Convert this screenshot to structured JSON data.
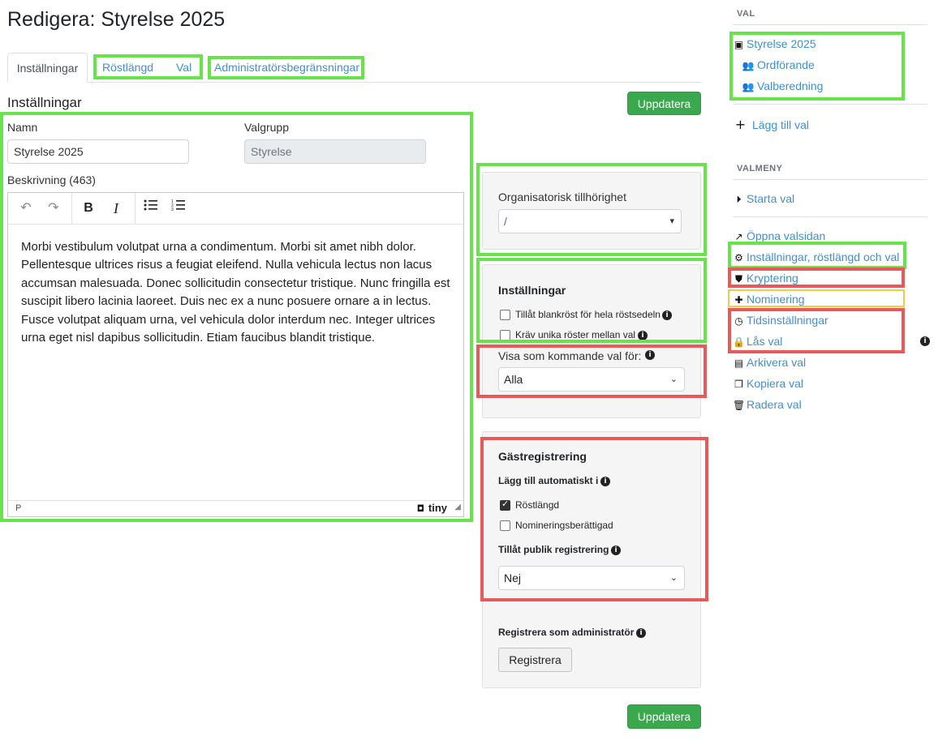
{
  "page": {
    "title": "Redigera: Styrelse 2025"
  },
  "tabs": [
    {
      "label": "Inställningar"
    },
    {
      "label": "Röstlängd"
    },
    {
      "label": "Val"
    },
    {
      "label": "Administratörsbegränsningar"
    }
  ],
  "settings": {
    "heading": "Inställningar",
    "update_label": "Uppdatera",
    "name_label": "Namn",
    "name_value": "Styrelse 2025",
    "group_label": "Valgrupp",
    "group_value": "Styrelse",
    "description_label": "Beskrivning (463)",
    "description_text": "Morbi vestibulum volutpat urna a condimentum. Morbi sit amet nibh dolor. Pellentesque ultrices risus a feugiat eleifend. Nulla vehicula lectus non lacus accumsan malesuada. Donec sollicitudin consectetur tristique. Nunc fringilla est suscipit libero lacinia laoreet. Duis nec ex a nunc posuere ornare a in lectus. Fusce volutpat aliquam urna, vel vehicula dolor interdum nec. Integer ultrices urna eget nisl dapibus sollicitudin. Etiam faucibus blandit tristique.",
    "editor_status": "P",
    "editor_brand": "tiny"
  },
  "org": {
    "label": "Organisatorisk tillhörighet",
    "value": "/"
  },
  "options": {
    "heading": "Inställningar",
    "blank_vote_label": "Tillåt blankröst för hela röstsedeln",
    "blank_vote_checked": false,
    "unique_votes_label": "Kräv unika röster mellan val",
    "unique_votes_checked": false,
    "upcoming_label": "Visa som kommande val för:",
    "upcoming_value": "Alla"
  },
  "guest": {
    "heading": "Gästregistrering",
    "auto_add_label": "Lägg till automatiskt i",
    "voter_roll_label": "Röstlängd",
    "voter_roll_checked": true,
    "nomination_label": "Nomineringsberättigad",
    "nomination_checked": false,
    "public_label": "Tillåt publik registrering",
    "public_value": "Nej",
    "admin_register_label": "Registrera som administratör",
    "register_button": "Registrera"
  },
  "sidebar": {
    "val_heading": "VAL",
    "elections": [
      {
        "label": "Styrelse 2025",
        "icon": "boxes-icon"
      },
      {
        "label": "Ordförande",
        "icon": "users-icon"
      },
      {
        "label": "Valberedning",
        "icon": "users-icon"
      }
    ],
    "add_label": "Lägg till val",
    "menu_heading": "VALMENY",
    "start_label": "Starta val",
    "menu_items": [
      {
        "label": "Öppna valsidan",
        "icon": "external-link-icon"
      },
      {
        "label": "Inställningar, röstlängd och val",
        "icon": "gear-icon"
      },
      {
        "label": "Kryptering",
        "icon": "shield-icon"
      },
      {
        "label": "Nominering",
        "icon": "comment-plus-icon"
      },
      {
        "label": "Tidsinställningar",
        "icon": "clock-icon"
      },
      {
        "label": "Lås val",
        "icon": "lock-icon"
      },
      {
        "label": "Arkivera val",
        "icon": "archive-icon"
      },
      {
        "label": "Kopiera val",
        "icon": "copy-icon"
      },
      {
        "label": "Radera val",
        "icon": "trash-icon"
      }
    ]
  },
  "colors": {
    "accent": "#3f8fd6",
    "button_green": "#3aa84c",
    "highlight_green": "#66e44a",
    "highlight_red": "#e85a5a",
    "highlight_yellow": "#f7c948"
  }
}
